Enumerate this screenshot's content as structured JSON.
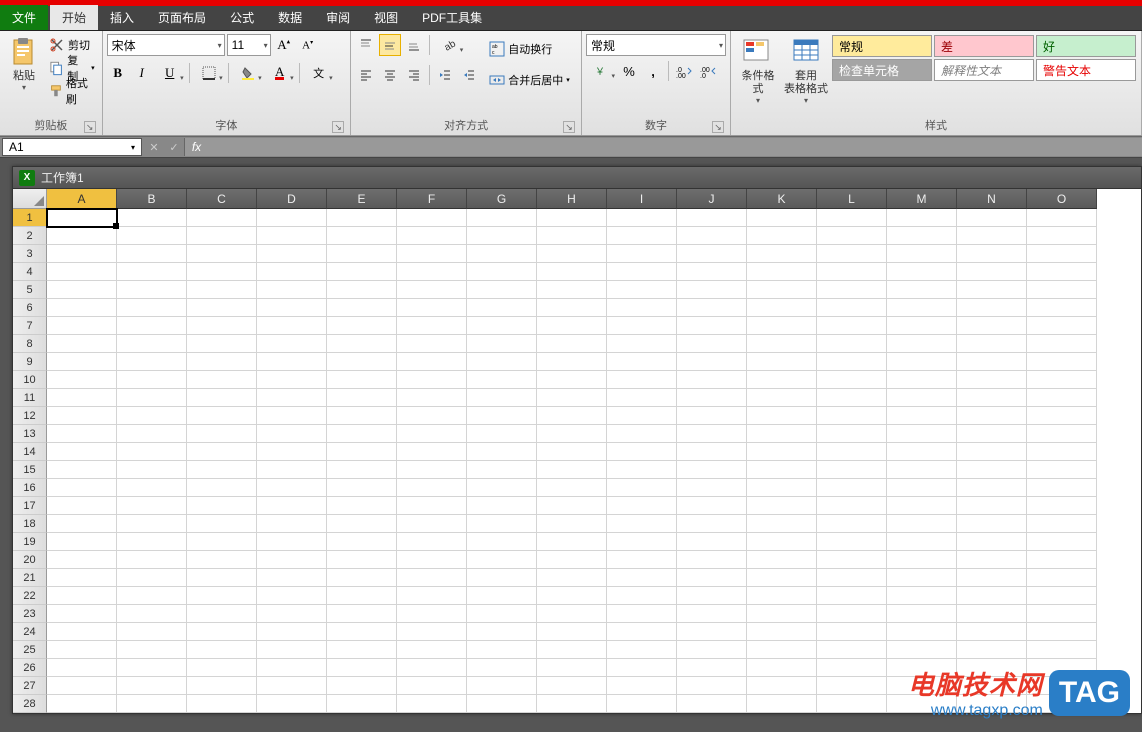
{
  "tabs": {
    "file": "文件",
    "items": [
      "开始",
      "插入",
      "页面布局",
      "公式",
      "数据",
      "审阅",
      "视图",
      "PDF工具集"
    ],
    "activeIndex": 0
  },
  "ribbon": {
    "clipboard": {
      "label": "剪贴板",
      "paste": "粘贴",
      "cut": "剪切",
      "copy": "复制",
      "formatPainter": "格式刷"
    },
    "font": {
      "label": "字体",
      "name": "宋体",
      "size": "11"
    },
    "alignment": {
      "label": "对齐方式",
      "wrap": "自动换行",
      "merge": "合并后居中"
    },
    "number": {
      "label": "数字",
      "format": "常规"
    },
    "styles": {
      "label": "样式",
      "conditional": "条件格式",
      "formatTable": "套用\n表格格式",
      "cells": {
        "normal": "常规",
        "bad": "差",
        "good": "好",
        "check": "检查单元格",
        "explanatory": "解释性文本",
        "warning": "警告文本"
      }
    }
  },
  "formulaBar": {
    "nameBox": "A1",
    "formula": ""
  },
  "workbook": {
    "title": "工作簿1",
    "columns": [
      "A",
      "B",
      "C",
      "D",
      "E",
      "F",
      "G",
      "H",
      "I",
      "J",
      "K",
      "L",
      "M",
      "N",
      "O"
    ],
    "rows": [
      1,
      2,
      3,
      4,
      5,
      6,
      7,
      8,
      9,
      10,
      11,
      12,
      13,
      14,
      15,
      16,
      17,
      18,
      19,
      20,
      21,
      22,
      23,
      24,
      25,
      26,
      27,
      28
    ],
    "activeCell": "A1"
  },
  "watermark": {
    "title": "电脑技术网",
    "url": "www.tagxp.com",
    "tag": "TAG"
  }
}
